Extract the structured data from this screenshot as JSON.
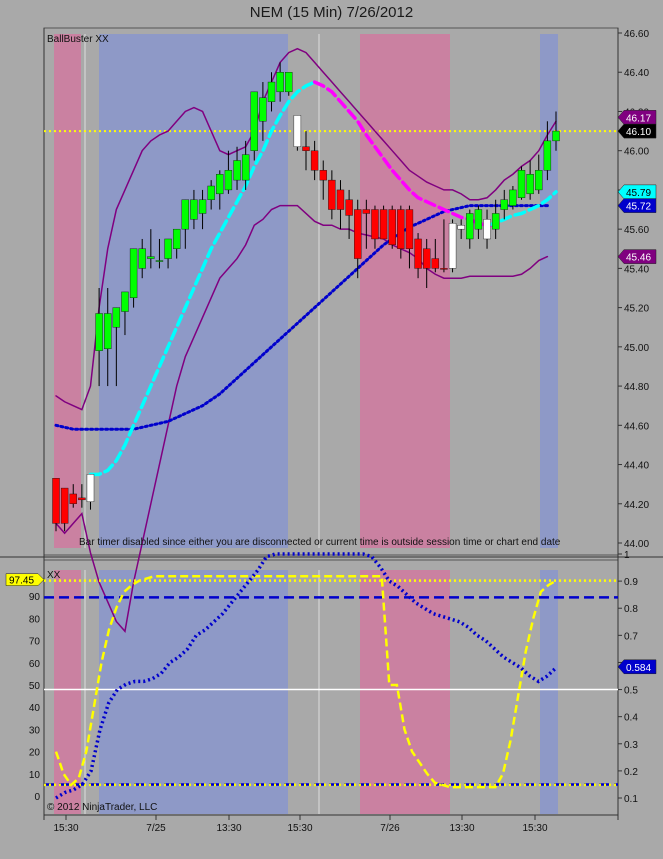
{
  "title": "NEM (15 Min)  7/26/2012",
  "price_panel": {
    "indicator_label": "BallBuster XX",
    "message": "Bar timer disabled since either you are disconnected or current time is outside session time or chart end date",
    "yticks": [
      "46.60",
      "46.40",
      "46.20",
      "46.00",
      "45.80",
      "45.60",
      "45.40",
      "45.20",
      "45.00",
      "44.80",
      "44.60",
      "44.40",
      "44.20",
      "44.00"
    ],
    "markers": [
      {
        "text": "46.17",
        "value": 46.17,
        "bg": "#800080",
        "fg": "#ffffff"
      },
      {
        "text": "46.10",
        "value": 46.1,
        "bg": "#000000",
        "fg": "#ffffff"
      },
      {
        "text": "45.79",
        "value": 45.79,
        "bg": "#00ffff",
        "fg": "#000000"
      },
      {
        "text": "45.72",
        "value": 45.72,
        "bg": "#0000cc",
        "fg": "#ffffff"
      },
      {
        "text": "45.46",
        "value": 45.46,
        "bg": "#800080",
        "fg": "#ffffff"
      }
    ]
  },
  "osc_panel": {
    "indicator_label": "XX",
    "copyright": "© 2012 NinjaTrader, LLC",
    "left_ticks": [
      "90",
      "80",
      "70",
      "60",
      "50",
      "40",
      "30",
      "20",
      "10",
      "0"
    ],
    "right_ticks": [
      "1",
      "0.9",
      "0.8",
      "0.7",
      "0.6",
      "0.5",
      "0.4",
      "0.3",
      "0.2",
      "0.1"
    ],
    "left_marker": {
      "text": "97.45",
      "bg": "#ffff00",
      "fg": "#000000"
    },
    "right_marker": {
      "text": "0.584",
      "bg": "#0000cc",
      "fg": "#ffffff"
    }
  },
  "x_axis": [
    "15:30",
    "7/25",
    "13:30",
    "15:30",
    "7/26",
    "13:30",
    "15:30"
  ],
  "colors": {
    "up": "#00ff00",
    "down": "#ff0000",
    "doji": "#ffffff",
    "pink_zone": "#d07aa0",
    "blue_zone": "#8a97cc"
  },
  "chart_data": {
    "type": "candlestick",
    "title": "NEM (15 Min)  7/26/2012",
    "price_ylim": [
      44.0,
      46.6
    ],
    "candles": [
      {
        "o": 44.1,
        "h": 44.33,
        "l": 44.06,
        "c": 44.33,
        "color": "down"
      },
      {
        "o": 44.1,
        "h": 44.28,
        "l": 44.06,
        "c": 44.28,
        "color": "down"
      },
      {
        "o": 44.2,
        "h": 44.3,
        "l": 44.18,
        "c": 44.25,
        "color": "down"
      },
      {
        "o": 44.22,
        "h": 44.3,
        "l": 44.18,
        "c": 44.23,
        "color": "down"
      },
      {
        "o": 44.21,
        "h": 44.35,
        "l": 44.17,
        "c": 44.35,
        "color": "doji"
      },
      {
        "o": 44.98,
        "h": 45.3,
        "l": 44.8,
        "c": 45.17,
        "color": "up"
      },
      {
        "o": 44.99,
        "h": 45.3,
        "l": 44.8,
        "c": 45.17,
        "color": "up"
      },
      {
        "o": 45.1,
        "h": 45.2,
        "l": 44.8,
        "c": 45.2,
        "color": "up"
      },
      {
        "o": 45.18,
        "h": 45.28,
        "l": 45.06,
        "c": 45.28,
        "color": "up"
      },
      {
        "o": 45.25,
        "h": 45.5,
        "l": 45.2,
        "c": 45.5,
        "color": "up"
      },
      {
        "o": 45.4,
        "h": 45.55,
        "l": 45.35,
        "c": 45.5,
        "color": "up"
      },
      {
        "o": 45.45,
        "h": 45.6,
        "l": 45.4,
        "c": 45.46,
        "color": "up"
      },
      {
        "o": 45.44,
        "h": 45.55,
        "l": 45.4,
        "c": 45.44,
        "color": "up"
      },
      {
        "o": 45.45,
        "h": 45.55,
        "l": 45.4,
        "c": 45.55,
        "color": "up"
      },
      {
        "o": 45.5,
        "h": 45.6,
        "l": 45.45,
        "c": 45.6,
        "color": "up"
      },
      {
        "o": 45.6,
        "h": 45.75,
        "l": 45.5,
        "c": 45.75,
        "color": "up"
      },
      {
        "o": 45.65,
        "h": 45.8,
        "l": 45.6,
        "c": 45.75,
        "color": "up"
      },
      {
        "o": 45.68,
        "h": 45.8,
        "l": 45.6,
        "c": 45.75,
        "color": "up"
      },
      {
        "o": 45.75,
        "h": 45.85,
        "l": 45.7,
        "c": 45.82,
        "color": "up"
      },
      {
        "o": 45.78,
        "h": 45.9,
        "l": 45.7,
        "c": 45.88,
        "color": "up"
      },
      {
        "o": 45.8,
        "h": 46.0,
        "l": 45.78,
        "c": 45.9,
        "color": "up"
      },
      {
        "o": 45.85,
        "h": 46.02,
        "l": 45.8,
        "c": 45.95,
        "color": "up"
      },
      {
        "o": 45.85,
        "h": 46.05,
        "l": 45.8,
        "c": 45.98,
        "color": "up"
      },
      {
        "o": 46.0,
        "h": 46.3,
        "l": 45.95,
        "c": 46.3,
        "color": "up"
      },
      {
        "o": 46.15,
        "h": 46.35,
        "l": 46.05,
        "c": 46.27,
        "color": "up"
      },
      {
        "o": 46.25,
        "h": 46.4,
        "l": 46.2,
        "c": 46.35,
        "color": "up"
      },
      {
        "o": 46.3,
        "h": 46.45,
        "l": 46.25,
        "c": 46.4,
        "color": "up"
      },
      {
        "o": 46.4,
        "h": 46.4,
        "l": 46.28,
        "c": 46.3,
        "color": "up"
      },
      {
        "o": 46.18,
        "h": 46.18,
        "l": 46.0,
        "c": 46.02,
        "color": "doji"
      },
      {
        "o": 46.02,
        "h": 46.1,
        "l": 45.9,
        "c": 46.0,
        "color": "down"
      },
      {
        "o": 46.0,
        "h": 46.05,
        "l": 45.85,
        "c": 45.9,
        "color": "down"
      },
      {
        "o": 45.9,
        "h": 45.95,
        "l": 45.75,
        "c": 45.85,
        "color": "down"
      },
      {
        "o": 45.85,
        "h": 45.9,
        "l": 45.65,
        "c": 45.7,
        "color": "down"
      },
      {
        "o": 45.8,
        "h": 45.85,
        "l": 45.6,
        "c": 45.7,
        "color": "down"
      },
      {
        "o": 45.75,
        "h": 45.8,
        "l": 45.55,
        "c": 45.67,
        "color": "down"
      },
      {
        "o": 45.7,
        "h": 45.75,
        "l": 45.35,
        "c": 45.45,
        "color": "down"
      },
      {
        "o": 45.7,
        "h": 45.75,
        "l": 45.5,
        "c": 45.68,
        "color": "down"
      },
      {
        "o": 45.7,
        "h": 45.72,
        "l": 45.5,
        "c": 45.55,
        "color": "down"
      },
      {
        "o": 45.7,
        "h": 45.72,
        "l": 45.55,
        "c": 45.55,
        "color": "down"
      },
      {
        "o": 45.7,
        "h": 45.72,
        "l": 45.5,
        "c": 45.52,
        "color": "down"
      },
      {
        "o": 45.7,
        "h": 45.72,
        "l": 45.45,
        "c": 45.5,
        "color": "down"
      },
      {
        "o": 45.7,
        "h": 45.72,
        "l": 45.4,
        "c": 45.5,
        "color": "down"
      },
      {
        "o": 45.55,
        "h": 45.58,
        "l": 45.35,
        "c": 45.4,
        "color": "down"
      },
      {
        "o": 45.5,
        "h": 45.55,
        "l": 45.3,
        "c": 45.4,
        "color": "down"
      },
      {
        "o": 45.45,
        "h": 45.55,
        "l": 45.38,
        "c": 45.4,
        "color": "down"
      },
      {
        "o": 45.4,
        "h": 45.65,
        "l": 45.38,
        "c": 45.4,
        "color": "down"
      },
      {
        "o": 45.4,
        "h": 45.65,
        "l": 45.38,
        "c": 45.63,
        "color": "doji"
      },
      {
        "o": 45.6,
        "h": 45.65,
        "l": 45.55,
        "c": 45.62,
        "color": "doji"
      },
      {
        "o": 45.55,
        "h": 45.7,
        "l": 45.5,
        "c": 45.68,
        "color": "up"
      },
      {
        "o": 45.6,
        "h": 45.72,
        "l": 45.55,
        "c": 45.7,
        "color": "up"
      },
      {
        "o": 45.65,
        "h": 45.7,
        "l": 45.5,
        "c": 45.55,
        "color": "doji"
      },
      {
        "o": 45.6,
        "h": 45.75,
        "l": 45.55,
        "c": 45.68,
        "color": "up"
      },
      {
        "o": 45.7,
        "h": 45.8,
        "l": 45.65,
        "c": 45.75,
        "color": "up"
      },
      {
        "o": 45.72,
        "h": 45.82,
        "l": 45.7,
        "c": 45.8,
        "color": "up"
      },
      {
        "o": 45.76,
        "h": 45.92,
        "l": 45.75,
        "c": 45.9,
        "color": "up"
      },
      {
        "o": 45.78,
        "h": 45.95,
        "l": 45.75,
        "c": 45.88,
        "color": "up"
      },
      {
        "o": 45.8,
        "h": 45.98,
        "l": 45.78,
        "c": 45.9,
        "color": "up"
      },
      {
        "o": 45.9,
        "h": 46.15,
        "l": 45.85,
        "c": 46.05,
        "color": "up"
      },
      {
        "o": 46.05,
        "h": 46.2,
        "l": 46.0,
        "c": 46.1,
        "color": "up"
      }
    ],
    "hline": 46.1,
    "upper_band": [
      44.75,
      44.72,
      44.7,
      44.68,
      44.8,
      45.2,
      45.5,
      45.7,
      45.8,
      45.9,
      46.0,
      46.05,
      46.08,
      46.1,
      46.15,
      46.2,
      46.22,
      46.2,
      46.1,
      46.0,
      45.98,
      46.0,
      46.02,
      46.1,
      46.25,
      46.35,
      46.45,
      46.5,
      46.52,
      46.5,
      46.45,
      46.4,
      46.35,
      46.3,
      46.25,
      46.2,
      46.15,
      46.1,
      46.05,
      46.0,
      45.95,
      45.9,
      45.87,
      45.84,
      45.82,
      45.8,
      45.8,
      45.78,
      45.75,
      45.75,
      45.76,
      45.8,
      45.85,
      45.88,
      45.92,
      45.95,
      46.0,
      46.08,
      46.15
    ],
    "lower_band": [
      44.1,
      44.05,
      44.1,
      44.15,
      43.95,
      43.8,
      43.7,
      43.6,
      43.55,
      43.8,
      44.0,
      44.2,
      44.4,
      44.6,
      44.8,
      44.95,
      45.05,
      45.15,
      45.25,
      45.35,
      45.4,
      45.45,
      45.52,
      45.62,
      45.65,
      45.7,
      45.72,
      45.72,
      45.72,
      45.68,
      45.64,
      45.62,
      45.62,
      45.6,
      45.6,
      45.58,
      45.57,
      45.56,
      45.55,
      45.52,
      45.5,
      45.48,
      45.45,
      45.4,
      45.37,
      45.35,
      45.35,
      45.35,
      45.36,
      45.36,
      45.36,
      45.36,
      45.36,
      45.36,
      45.37,
      45.4,
      45.44,
      45.46
    ],
    "cyan_line": [
      null,
      null,
      null,
      null,
      44.35,
      44.35,
      44.37,
      44.42,
      44.5,
      44.6,
      44.7,
      44.8,
      44.9,
      45.0,
      45.1,
      45.2,
      45.3,
      45.4,
      45.5,
      45.58,
      45.66,
      45.74,
      45.82,
      45.92,
      46.0,
      46.1,
      46.18,
      46.25,
      46.3,
      46.33,
      46.35
    ],
    "magenta_line": [
      null,
      null,
      null,
      null,
      null,
      null,
      null,
      null,
      null,
      null,
      null,
      null,
      null,
      null,
      null,
      null,
      null,
      null,
      null,
      null,
      null,
      null,
      null,
      null,
      null,
      null,
      null,
      null,
      null,
      null,
      46.35,
      46.33,
      46.3,
      46.25,
      46.2,
      46.15,
      46.08,
      46.02,
      45.96,
      45.9,
      45.85,
      45.8,
      45.76,
      45.74,
      45.72,
      45.7,
      45.68,
      45.66,
      45.65,
      45.63,
      45.62,
      45.62
    ],
    "cyan_tail": [
      45.62,
      45.63,
      45.65,
      45.67,
      45.68,
      45.7,
      45.72,
      45.75,
      45.79
    ],
    "blue_dotted": [
      44.6,
      44.59,
      44.58,
      44.58,
      44.58,
      44.58,
      44.58,
      44.58,
      44.58,
      44.58,
      44.59,
      44.6,
      44.61,
      44.62,
      44.64,
      44.66,
      44.68,
      44.7,
      44.73,
      44.76,
      44.8,
      44.84,
      44.88,
      44.92,
      44.96,
      45.0,
      45.04,
      45.08,
      45.12,
      45.16,
      45.2,
      45.24,
      45.28,
      45.32,
      45.36,
      45.4,
      45.44,
      45.48,
      45.52,
      45.55,
      45.58,
      45.61,
      45.63,
      45.65,
      45.67,
      45.69,
      45.7,
      45.71,
      45.72,
      45.72,
      45.72,
      45.72,
      45.72,
      45.72,
      45.72,
      45.72,
      45.72,
      45.72
    ],
    "osc_left_ylim": [
      0,
      100
    ],
    "osc_right_ylim": [
      0.1,
      1.0
    ],
    "osc_yellow": [
      20,
      10,
      5,
      8,
      20,
      40,
      60,
      75,
      85,
      92,
      95,
      97,
      98,
      99,
      99,
      99,
      99,
      99,
      99,
      99,
      99,
      99,
      99,
      99,
      99,
      99,
      99,
      99,
      99,
      99,
      99,
      99,
      99,
      99,
      99,
      99,
      99,
      99,
      99,
      99,
      99,
      99,
      99,
      99,
      50,
      50,
      30,
      20,
      15,
      10,
      6,
      5,
      4,
      4,
      4,
      4,
      4,
      4,
      4,
      10,
      25,
      45,
      65,
      80,
      92,
      95,
      97
    ],
    "osc_blue_dotted": [
      0.1,
      0.12,
      0.13,
      0.15,
      0.2,
      0.35,
      0.45,
      0.5,
      0.52,
      0.53,
      0.53,
      0.54,
      0.56,
      0.6,
      0.62,
      0.65,
      0.7,
      0.72,
      0.75,
      0.78,
      0.82,
      0.86,
      0.9,
      0.94,
      0.99,
      1.0,
      1.0,
      1.0,
      1.0,
      1.0,
      1.0,
      1.0,
      1.0,
      1.0,
      1.0,
      1.0,
      0.99,
      0.95,
      0.9,
      0.88,
      0.85,
      0.82,
      0.8,
      0.78,
      0.77,
      0.76,
      0.75,
      0.73,
      0.7,
      0.68,
      0.65,
      0.62,
      0.6,
      0.58,
      0.55,
      0.53,
      0.55,
      0.58
    ],
    "osc_hlines": [
      {
        "value": 97.0,
        "color": "#ffff00",
        "style": "dotted"
      },
      {
        "value": 0.84,
        "color": "#0000cc",
        "style": "dashed",
        "axis": "right"
      },
      {
        "value": 0.5,
        "color": "#ffffff",
        "style": "solid",
        "axis": "right"
      },
      {
        "value": 0.15,
        "color": "#0000cc",
        "style": "dashed",
        "axis": "right"
      },
      {
        "value": 5,
        "color": "#ffff00",
        "style": "dotted"
      }
    ],
    "xlabels": [
      "15:30",
      "7/25",
      "13:30",
      "15:30",
      "7/26",
      "13:30",
      "15:30"
    ]
  }
}
